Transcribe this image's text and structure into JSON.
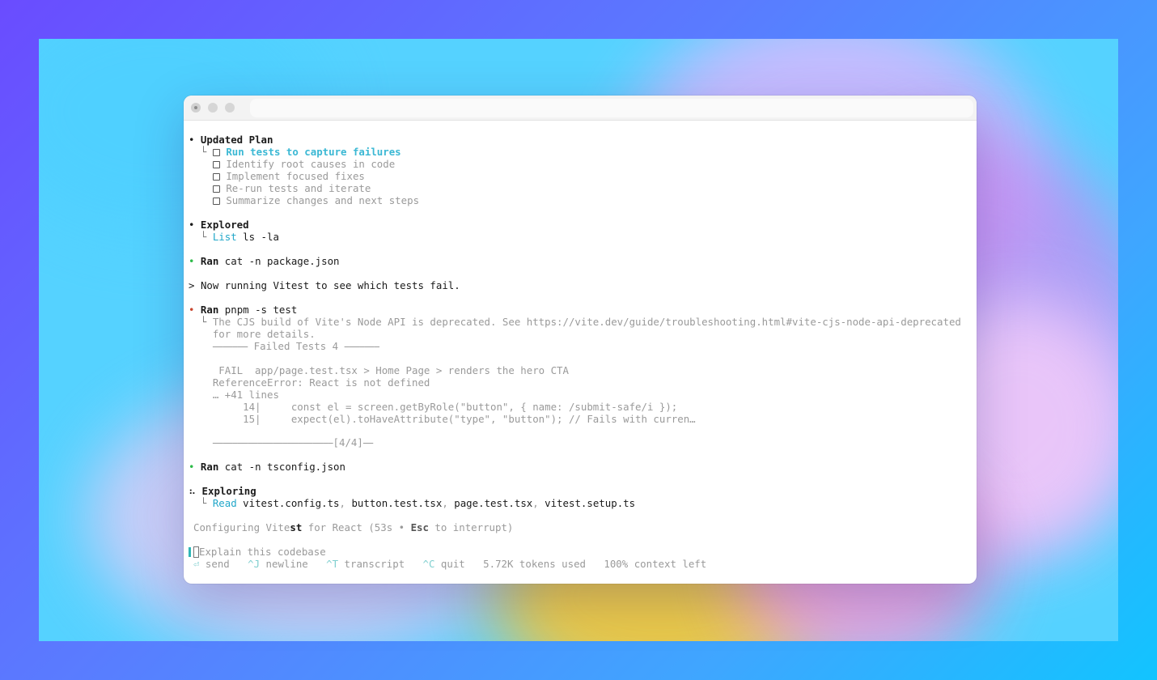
{
  "plan": {
    "title": "Updated Plan",
    "items": [
      "Run tests to capture failures",
      "Identify root causes in code",
      "Implement focused fixes",
      "Re-run tests and iterate",
      "Summarize changes and next steps"
    ]
  },
  "explored": {
    "title": "Explored",
    "action": "List",
    "arg": "ls -la"
  },
  "ran1": {
    "label": "Ran",
    "cmd": "cat -n package.json"
  },
  "note": {
    "prompt": ">",
    "text": "Now running Vitest to see which tests fail."
  },
  "ran2": {
    "label": "Ran",
    "cmd": "pnpm -s test",
    "out": {
      "l1": "The CJS build of Vite's Node API is deprecated. See https://vite.dev/guide/troubleshooting.html#vite-cjs-node-api-deprecated",
      "l2": "for more details.",
      "l3": "⎯⎯⎯⎯⎯⎯⎯ Failed Tests 4 ⎯⎯⎯⎯⎯⎯⎯",
      "l4": " FAIL  app/page.test.tsx > Home Page > renders the hero CTA",
      "l5": "ReferenceError: React is not defined",
      "l6": "… +41 lines",
      "l7": "     14|     const el = screen.getByRole(\"button\", { name: /submit-safe/i });",
      "l8": "     15|     expect(el).toHaveAttribute(\"type\", \"button\"); // Fails with curren…",
      "l9": "⎯⎯⎯⎯⎯⎯⎯⎯⎯⎯⎯⎯⎯⎯⎯⎯⎯⎯⎯⎯⎯⎯⎯⎯[4/4]⎯⎯"
    }
  },
  "ran3": {
    "label": "Ran",
    "cmd": "cat -n tsconfig.json"
  },
  "exploring": {
    "title": "Exploring",
    "action": "Read",
    "files": [
      "vitest.config.ts",
      "button.test.tsx",
      "page.test.tsx",
      "vitest.setup.ts"
    ]
  },
  "status": {
    "pre": "Configuring Vite",
    "bold": "st",
    "post": " for React (53s • ",
    "key": "Esc",
    "tail": " to interrupt)"
  },
  "input": {
    "placeholder": "Explain this codebase"
  },
  "footer": {
    "send_key": "⏎",
    "send": " send",
    "newline_key": "^J",
    "newline": " newline",
    "transcript_key": "^T",
    "transcript": " transcript",
    "quit_key": "^C",
    "quit": " quit",
    "tokens": "5.72K tokens used",
    "context": "100% context left"
  },
  "colors": {
    "accent": "#22a7c9",
    "ok": "#2dbb49",
    "fail": "#c8452e"
  }
}
